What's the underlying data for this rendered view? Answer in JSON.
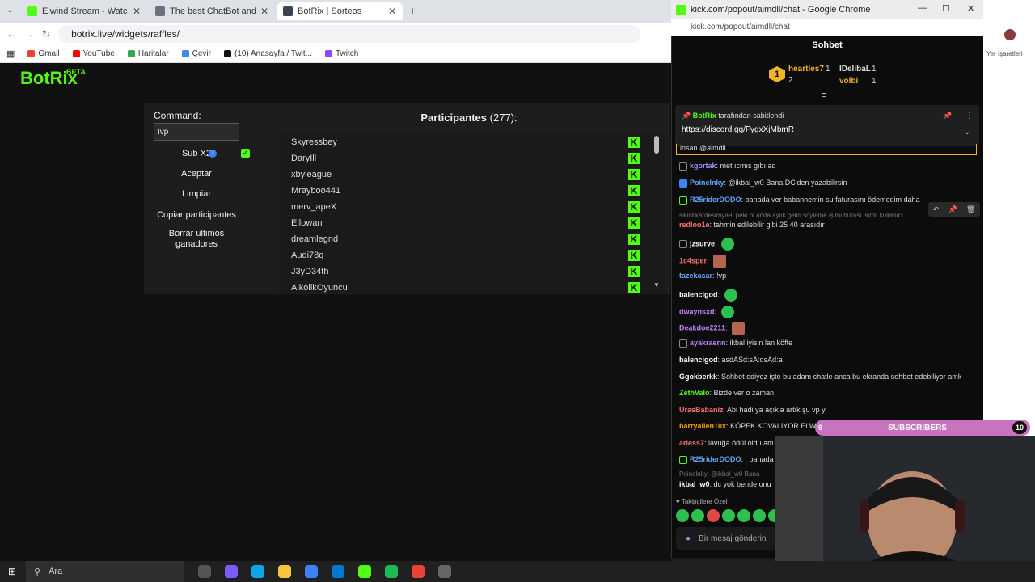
{
  "browser": {
    "tabs": [
      {
        "label": "Elwind Stream - Watch Live on K",
        "color": "#53fc18",
        "active": false
      },
      {
        "label": "The best ChatBot and Widgets for",
        "color": "#6b7280",
        "active": false
      },
      {
        "label": "BotRix | Sorteos",
        "color": "#3b4252",
        "active": true
      }
    ],
    "url": "botrix.live/widgets/raffles/",
    "bookmarks": [
      {
        "label": "Gmail",
        "color": "#ea4335"
      },
      {
        "label": "YouTube",
        "color": "#ff0000"
      },
      {
        "label": "Haritalar",
        "color": "#34a853"
      },
      {
        "label": "Çevir",
        "color": "#4285f4"
      },
      {
        "label": "(10) Anasayfa / Twit...",
        "color": "#111111"
      },
      {
        "label": "Twitch",
        "color": "#9146ff"
      }
    ]
  },
  "page": {
    "logo": "BotRix",
    "beta": "BETA",
    "command_label": "Command:",
    "command_value": "!vp",
    "sub_label": "Sub X2",
    "buttons": [
      "Aceptar",
      "Limpiar",
      "Copiar participantes",
      "Borrar ultimos ganadores"
    ],
    "participants_label": "Participantes",
    "participants_count": "(277):",
    "participants": [
      "Skyressbey",
      "DaryIll",
      "xbyleague",
      "Mrayboo441",
      "merv_apeX",
      "Ellowan",
      "dreamlegnd",
      "Audi78q",
      "J3yD34th",
      "AlkolikOyuncu"
    ]
  },
  "chat_window": {
    "title": "kick.com/popout/aimdll/chat - Google Chrome",
    "url": "kick.com/popout/aimdll/chat",
    "heading": "Sohbet",
    "leaderboard": [
      {
        "rank": "1",
        "name": "heartles7",
        "count": "1"
      },
      {
        "rank": "2",
        "name": "",
        "count": "2"
      },
      {
        "rank": "",
        "name": "IDelibaL",
        "count": "1"
      },
      {
        "rank": "",
        "name": "volbi",
        "count": "1"
      }
    ],
    "pinned_by": "BotRix",
    "pinned_suffix": "tarafından sabitlendi",
    "pinned_link": "https://discord.gg/FygxXjMbmR",
    "pinned_cut": "insan @aimdll",
    "messages": [
      {
        "user": "kgortak",
        "color": "#a78bfa",
        "text": "met ıcmıs gıbı aq"
      },
      {
        "user": "PoineInky",
        "color": "#60a5fa",
        "text": "@ikbal_w0 Bana DC'den yazabilirsin"
      },
      {
        "user": "R25riderDODO",
        "color": "#60a5fa",
        "text": "banada ver babannemin su faturasını ödemedim daha"
      },
      {
        "user": "redloo1e",
        "color": "#f87171",
        "text": "tahmin edilebilir gibi 25 40 arasıdır"
      },
      {
        "user": "jzsurve",
        "color": "#ffffff",
        "text": ""
      },
      {
        "user": "1c4sper",
        "color": "#f87171",
        "text": ""
      },
      {
        "user": "tazekasar",
        "color": "#60a5fa",
        "text": "!vp"
      },
      {
        "user": "balencigod",
        "color": "#ffffff",
        "text": ""
      },
      {
        "user": "dwaynsxd",
        "color": "#c084fc",
        "text": ""
      },
      {
        "user": "Deakdoe2211",
        "color": "#c084fc",
        "text": ""
      },
      {
        "user": "ayakraenn",
        "color": "#c084fc",
        "text": "ikbal iyisin lan köfte"
      },
      {
        "user": "balencigod",
        "color": "#ffffff",
        "text": "asdASd:sA:dsAd:a"
      },
      {
        "user": "Ggokberkk",
        "color": "#ffffff",
        "text": "Sohbet ediyoz işte bu adam chatle anca bu ekranda sohbet edebiliyor amk"
      },
      {
        "user": "ZethValo",
        "color": "#53fc18",
        "text": "Bizde ver o zaman"
      },
      {
        "user": "UrasBabaniz",
        "color": "#f87171",
        "text": "Abi hadi ya açıkla artık şu vp yi"
      },
      {
        "user": "barryallen10x",
        "color": "#f59e0b",
        "text": "KÖPEK KOVALIYOR ELWIN"
      },
      {
        "user": "arless7",
        "color": "#f87171",
        "text": "lavuğa ödül oldu am"
      },
      {
        "user": "R25riderDODO",
        "color": "#60a5fa",
        "text": ": banada"
      },
      {
        "user": "ikbal_w0",
        "color": "#ffffff",
        "text": "dc yok bende onu"
      }
    ],
    "reply_lines": [
      "sikintikardesimya9: peki bi anda aylık geliri söyleme işimi burası isimli kullanıcı",
      "Poinelnky: @ikbal_w0 Bana"
    ],
    "followers_only": "Takipçilere Özel",
    "input_placeholder": "Bir mesaj gönderin"
  },
  "overlay": {
    "subscribers_label": "SUBSCRIBERS",
    "sub_current": "9",
    "sub_goal": "10",
    "bar_color": "#c873c0"
  },
  "desktop": {
    "bookmarks_label": "Yer İşaretleri"
  },
  "taskbar": {
    "search_label": "Ara"
  }
}
